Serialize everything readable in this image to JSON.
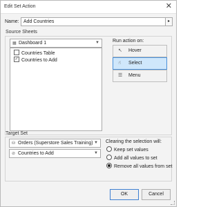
{
  "window": {
    "title": "Edit Set Action",
    "close_glyph": "✕"
  },
  "name": {
    "label": "Name:",
    "value": "Add Countries",
    "menu_arrow": "▸"
  },
  "source_sheets": {
    "heading": "Source Sheets",
    "dashboard": {
      "icon": "dashboard-icon",
      "value": "Dashboard 1"
    },
    "sheets": [
      {
        "label": "Countries Table",
        "checked": false
      },
      {
        "label": "Countries to Add",
        "checked": true
      }
    ]
  },
  "run_action": {
    "label": "Run action on:",
    "options": [
      {
        "label": "Hover",
        "icon": "cursor-icon",
        "selected": false
      },
      {
        "label": "Select",
        "icon": "pointer-icon",
        "selected": true
      },
      {
        "label": "Menu",
        "icon": "menu-icon",
        "selected": false
      }
    ]
  },
  "target_set": {
    "heading": "Target Set",
    "data_source": {
      "icon": "datasource-icon",
      "value": "Orders (Superstore Sales Training)"
    },
    "set": {
      "icon": "set-icon",
      "value": "Countries to Add"
    }
  },
  "clearing": {
    "label": "Clearing the selection will:",
    "options": [
      {
        "label": "Keep set values",
        "selected": false
      },
      {
        "label": "Add all values to set",
        "selected": false
      },
      {
        "label": "Remove all values from set",
        "selected": true
      }
    ]
  },
  "footer": {
    "ok": "OK",
    "cancel": "Cancel"
  },
  "colors": {
    "selected_bg": "#cfe7fb",
    "selected_border": "#4a90d9"
  }
}
